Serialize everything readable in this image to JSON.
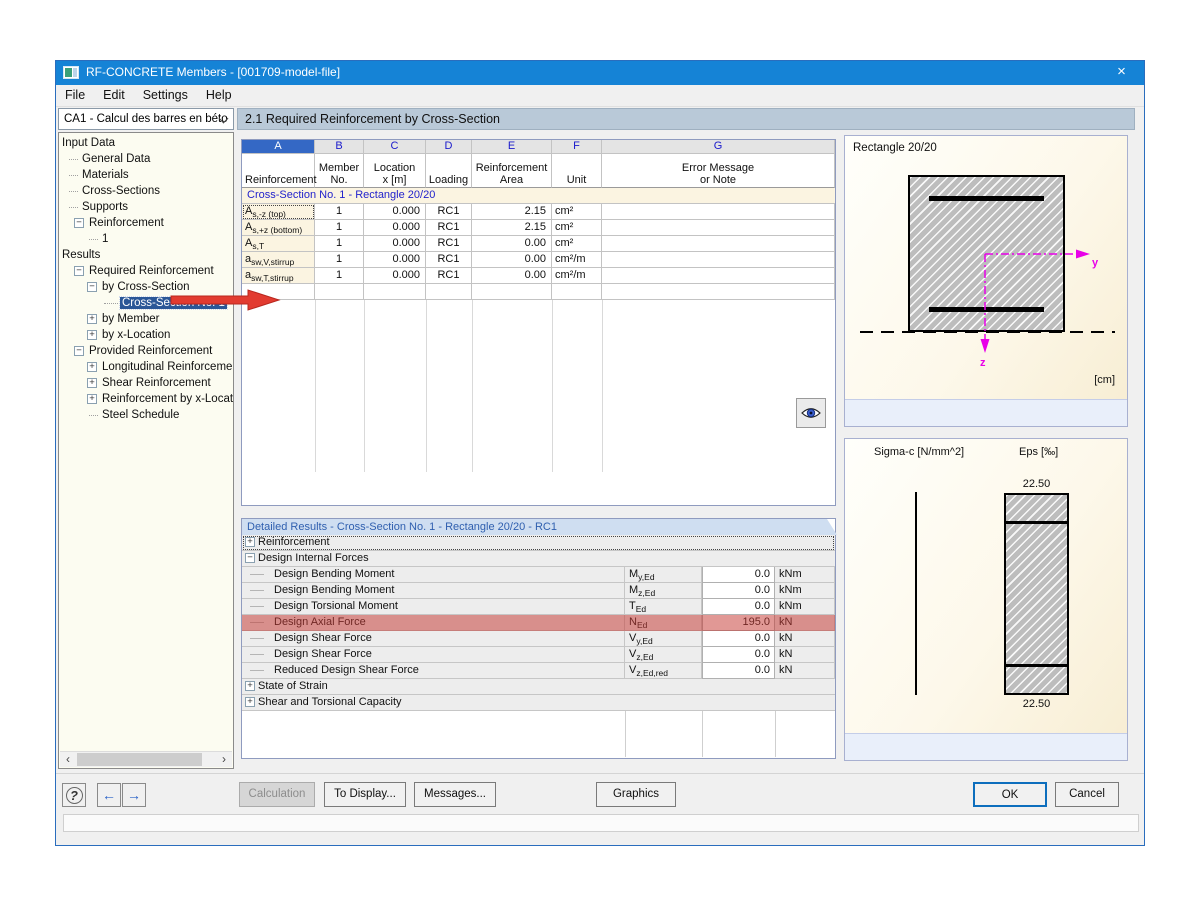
{
  "window": {
    "title": "RF-CONCRETE Members - [001709-model-file]"
  },
  "icons": {
    "close": "×",
    "help": "?",
    "nav_prev": "←",
    "nav_next": "→",
    "scroll_left": "‹",
    "scroll_right": "›",
    "collapse": "−",
    "expand": "+"
  },
  "menu": {
    "items": [
      "File",
      "Edit",
      "Settings",
      "Help"
    ]
  },
  "toolbar": {
    "case_selector": "CA1 - Calcul des barres en béto",
    "section_title": "2.1 Required Reinforcement by Cross-Section"
  },
  "tree": {
    "items": [
      "Input Data",
      "General Data",
      "Materials",
      "Cross-Sections",
      "Supports",
      "Reinforcement",
      "1",
      "Results",
      "Required Reinforcement",
      "by Cross-Section",
      "Cross-Section No. 1",
      "by Member",
      "by x-Location",
      "Provided Reinforcement",
      "Longitudinal Reinforcement",
      "Shear Reinforcement",
      "Reinforcement by x-Location",
      "Steel Schedule"
    ]
  },
  "req_table": {
    "col_letters": [
      "A",
      "B",
      "C",
      "D",
      "E",
      "F",
      "G"
    ],
    "headers": {
      "a": "Reinforcement",
      "b1": "Member",
      "b2": "No.",
      "c1": "Location",
      "c2": "x [m]",
      "d": "Loading",
      "e1": "Reinforcement",
      "e2": "Area",
      "f": "Unit",
      "g1": "Error Message",
      "g2": "or Note"
    },
    "group_row": "Cross-Section No. 1 - Rectangle 20/20",
    "rows": [
      {
        "sym": "A",
        "sub": "s,-z (top)",
        "member": "1",
        "x": "0.000",
        "loading": "RC1",
        "area": "2.15",
        "unit": "cm²"
      },
      {
        "sym": "A",
        "sub": "s,+z (bottom)",
        "member": "1",
        "x": "0.000",
        "loading": "RC1",
        "area": "2.15",
        "unit": "cm²"
      },
      {
        "sym": "A",
        "sub": "s,T",
        "member": "1",
        "x": "0.000",
        "loading": "RC1",
        "area": "0.00",
        "unit": "cm²"
      },
      {
        "sym": "a",
        "sub": "sw,V,stirrup",
        "member": "1",
        "x": "0.000",
        "loading": "RC1",
        "area": "0.00",
        "unit": "cm²/m"
      },
      {
        "sym": "a",
        "sub": "sw,T,stirrup",
        "member": "1",
        "x": "0.000",
        "loading": "RC1",
        "area": "0.00",
        "unit": "cm²/m"
      }
    ]
  },
  "detail_table": {
    "title": "Detailed Results  -  Cross-Section No. 1 - Rectangle 20/20  -  RC1",
    "cat_reinforcement": "Reinforcement",
    "cat_internal_forces": "Design Internal Forces",
    "cat_strain": "State of Strain",
    "cat_shear": "Shear and Torsional Capacity",
    "rows": [
      {
        "label": "Design Bending Moment",
        "sym": "M",
        "sub": "y,Ed",
        "value": "0.0",
        "unit": "kNm"
      },
      {
        "label": "Design Bending Moment",
        "sym": "M",
        "sub": "z,Ed",
        "value": "0.0",
        "unit": "kNm"
      },
      {
        "label": "Design Torsional Moment",
        "sym": "T",
        "sub": "Ed",
        "value": "0.0",
        "unit": "kNm"
      },
      {
        "label": "Design Axial Force",
        "sym": "N",
        "sub": "Ed",
        "value": "195.0",
        "unit": "kN"
      },
      {
        "label": "Design Shear Force",
        "sym": "V",
        "sub": "y,Ed",
        "value": "0.0",
        "unit": "kN"
      },
      {
        "label": "Design Shear Force",
        "sym": "V",
        "sub": "z,Ed",
        "value": "0.0",
        "unit": "kN"
      },
      {
        "label": "Reduced Design Shear Force",
        "sym": "V",
        "sub": "z,Ed,red",
        "value": "0.0",
        "unit": "kN"
      }
    ]
  },
  "graphics_top": {
    "label": "Rectangle 20/20",
    "unit": "[cm]",
    "axis_y": "y",
    "axis_z": "z"
  },
  "graphics_bottom": {
    "stress_label": "Sigma-c [N/mm^2]",
    "strain_label": "Eps [‰]",
    "top_value": "22.50",
    "bottom_value": "22.50"
  },
  "footer": {
    "calculation": "Calculation",
    "to_display": "To Display...",
    "messages": "Messages...",
    "graphics": "Graphics",
    "ok": "OK",
    "cancel": "Cancel"
  },
  "colors": {
    "titlebar": "#1583d6",
    "selection": "#2b5797",
    "highlight_red": "#c63a34",
    "magenta": "#e800e8",
    "accent_blue": "#0d6ebd"
  }
}
